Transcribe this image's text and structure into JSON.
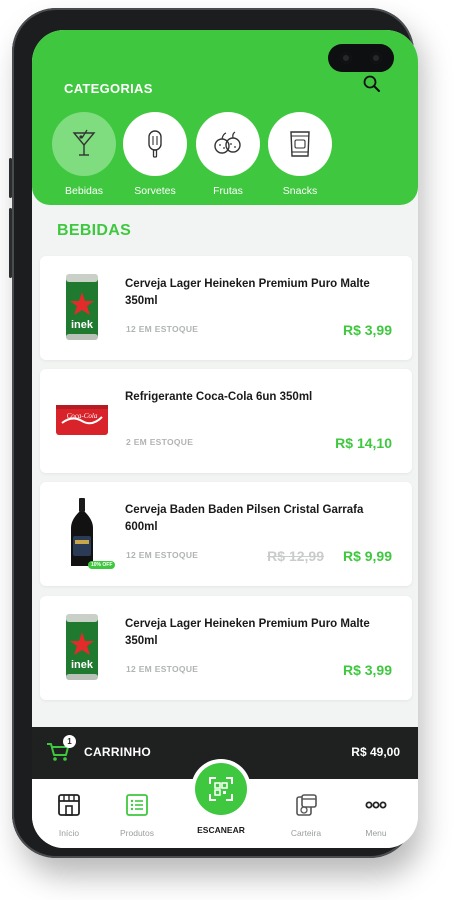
{
  "header": {
    "title": "CATEGORIAS",
    "search_icon": "search-icon",
    "categories": [
      {
        "label": "Bebidas",
        "icon": "cocktail-icon",
        "active": true
      },
      {
        "label": "Sorvetes",
        "icon": "popsicle-icon",
        "active": false
      },
      {
        "label": "Frutas",
        "icon": "fruits-icon",
        "active": false
      },
      {
        "label": "Snacks",
        "icon": "snack-bag-icon",
        "active": false
      }
    ]
  },
  "section": {
    "title": "BEBIDAS"
  },
  "products": [
    {
      "name": "Cerveja Lager Heineken Premium Puro Malte 350ml",
      "stock": "12 EM ESTOQUE",
      "price": "R$ 3,99"
    },
    {
      "name": "Refrigerante Coca-Cola 6un 350ml",
      "stock": "2 EM ESTOQUE",
      "price": "R$ 14,10"
    },
    {
      "name": "Cerveja Baden Baden Pilsen Cristal Garrafa 600ml",
      "stock": "12 EM ESTOQUE",
      "old_price": "R$ 12,99",
      "price": "R$ 9,99",
      "badge": "10% OFF"
    },
    {
      "name": "Cerveja Lager Heineken Premium Puro Malte 350ml",
      "stock": "12 EM ESTOQUE",
      "price": "R$ 3,99"
    }
  ],
  "cart": {
    "count": "1",
    "label": "CARRINHO",
    "total": "R$ 49,00"
  },
  "nav": {
    "items": [
      {
        "label": "Início",
        "icon": "store-icon"
      },
      {
        "label": "Produtos",
        "icon": "list-icon"
      },
      {
        "label": "ESCANEAR",
        "icon": "qr-scan-icon"
      },
      {
        "label": "Carteira",
        "icon": "wallet-icon"
      },
      {
        "label": "Menu",
        "icon": "more-dots-icon"
      }
    ]
  },
  "colors": {
    "brand_green": "#3fc83f",
    "dark_bar": "#1f2020",
    "muted": "#9a9e9c"
  }
}
